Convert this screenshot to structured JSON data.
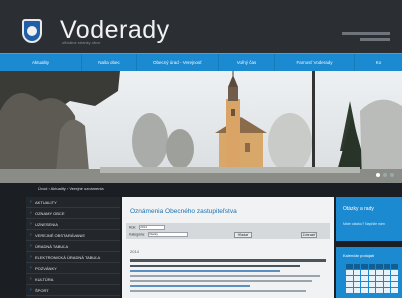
{
  "header": {
    "brand_name": "Voderady",
    "tagline": "oficiálne stránky obce"
  },
  "nav": {
    "items": [
      {
        "label": "Aktuality"
      },
      {
        "label": "Naša obec"
      },
      {
        "label": "Obecný úrad - Verejnosť"
      },
      {
        "label": "Voľný čas"
      },
      {
        "label": "Farnosť Voderady"
      },
      {
        "label": "Ko"
      }
    ]
  },
  "breadcrumb": {
    "text": "Úvod › Aktuality › Verejné oznámenia"
  },
  "sidebar": {
    "items": [
      {
        "label": "AKTUALITY"
      },
      {
        "label": "OZNAMY OBCE"
      },
      {
        "label": "UZNESENIA"
      },
      {
        "label": "VEREJNÉ OBSTARÁVANIE"
      },
      {
        "label": "ÚRADNÁ TABUĽA"
      },
      {
        "label": "ELEKTRONICKÁ ÚRADNÁ TABUĽA"
      },
      {
        "label": "POZVÁNKY"
      },
      {
        "label": "KULTÚRA"
      },
      {
        "label": "ŠPORT"
      }
    ]
  },
  "main": {
    "title": "Oznámenia Obecného zastupiteľstva",
    "form": {
      "year_label": "Rok:",
      "year_value": "2014",
      "category_label": "Kategória:",
      "category_value": "Všetky",
      "search_button": "Hľadať",
      "show_button": "Zobraziť"
    },
    "section_heading": "2014"
  },
  "widgets": {
    "info": {
      "title": "Otázky a rady",
      "text": "Máte otázku? Napíšte nám"
    },
    "calendar": {
      "title": "Kalendár podujatí"
    }
  },
  "colors": {
    "accent": "#1c8ad1",
    "header_bg": "#2b2f34",
    "page_bg": "#1b1f24",
    "sidebar_bg": "#23272c",
    "content_bg": "#f1f2f3",
    "title_blue": "#1c72b3"
  }
}
